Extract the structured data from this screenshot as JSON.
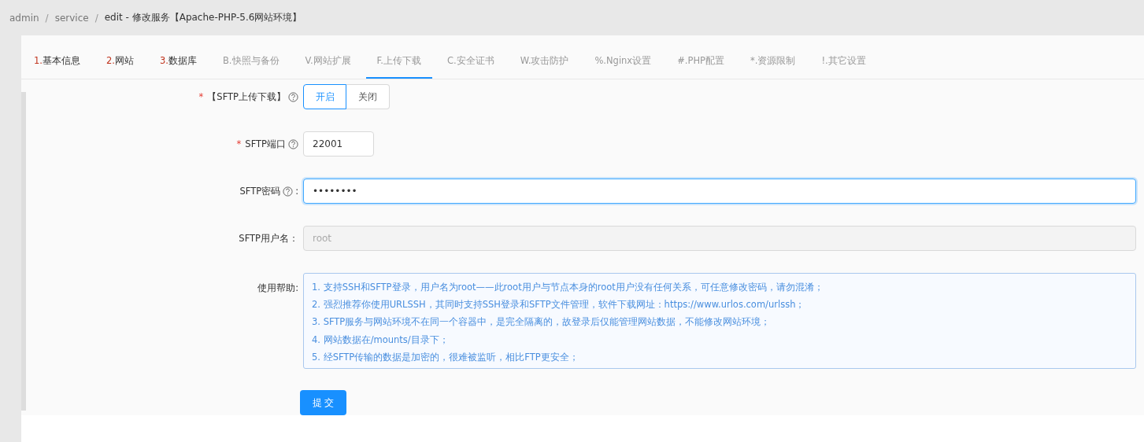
{
  "breadcrumb": [
    {
      "label": "admin",
      "current": false
    },
    {
      "separator": "/",
      "label": "service",
      "current": false
    },
    {
      "separator": "/",
      "label": "edit  -  修改服务【Apache-PHP-5.6网站环境】",
      "current": true
    }
  ],
  "tabs": [
    {
      "prefix": "1.",
      "label": "基本信息",
      "marked": true,
      "selected": false
    },
    {
      "prefix": "2.",
      "label": "网站",
      "marked": true,
      "selected": false
    },
    {
      "prefix": "3.",
      "label": "数据库",
      "marked": true,
      "selected": false
    },
    {
      "prefix": "B.",
      "label": "快照与备份",
      "marked": false,
      "selected": false
    },
    {
      "prefix": "V.",
      "label": "网站扩展",
      "marked": false,
      "selected": false
    },
    {
      "prefix": "F.",
      "label": "上传下载",
      "marked": false,
      "selected": true
    },
    {
      "prefix": "C.",
      "label": "安全证书",
      "marked": false,
      "selected": false
    },
    {
      "prefix": "W.",
      "label": "攻击防护",
      "marked": false,
      "selected": false
    },
    {
      "prefix": "%.",
      "label": "Nginx设置",
      "marked": false,
      "selected": false
    },
    {
      "prefix": "#.",
      "label": "PHP配置",
      "marked": false,
      "selected": false
    },
    {
      "prefix": "*.",
      "label": "资源限制",
      "marked": false,
      "selected": false
    },
    {
      "prefix": "!.",
      "label": "其它设置",
      "marked": false,
      "selected": false
    }
  ],
  "fields": [
    {
      "kind": "toggle",
      "required_mark": "*",
      "label": "【SFTP上传下载】",
      "help": true,
      "options": [
        {
          "label": "开启",
          "selected": true
        },
        {
          "label": "关闭",
          "selected": false
        }
      ]
    },
    {
      "kind": "short_input",
      "required_mark": "*",
      "label": "SFTP端口",
      "help": true,
      "value": "22001",
      "focused": false,
      "disabled": false
    },
    {
      "kind": "input",
      "label": "SFTP密码",
      "suffix": ":",
      "help": true,
      "value": "••••••••",
      "focused": true,
      "disabled": false
    },
    {
      "kind": "input",
      "label": "SFTP用户名：",
      "help": false,
      "value": "root",
      "focused": false,
      "disabled": true
    },
    {
      "kind": "help",
      "label": "使用帮助:",
      "help": false,
      "lines": [
        "1. 支持SSH和SFTP登录，用户名为root——此root用户与节点本身的root用户没有任何关系，可任意修改密码，请勿混淆；",
        "2. 强烈推荐你使用URLSSH，其同时支持SSH登录和SFTP文件管理，软件下载网址：https://www.urlos.com/urlssh；",
        "3. SFTP服务与网站环境不在同一个容器中，是完全隔离的，故登录后仅能管理网站数据，不能修改网站环境；",
        "4. 网站数据在/mounts/目录下；",
        "5. 经SFTP传输的数据是加密的，很难被监听，相比FTP更安全；"
      ]
    }
  ],
  "submit": "提 交"
}
